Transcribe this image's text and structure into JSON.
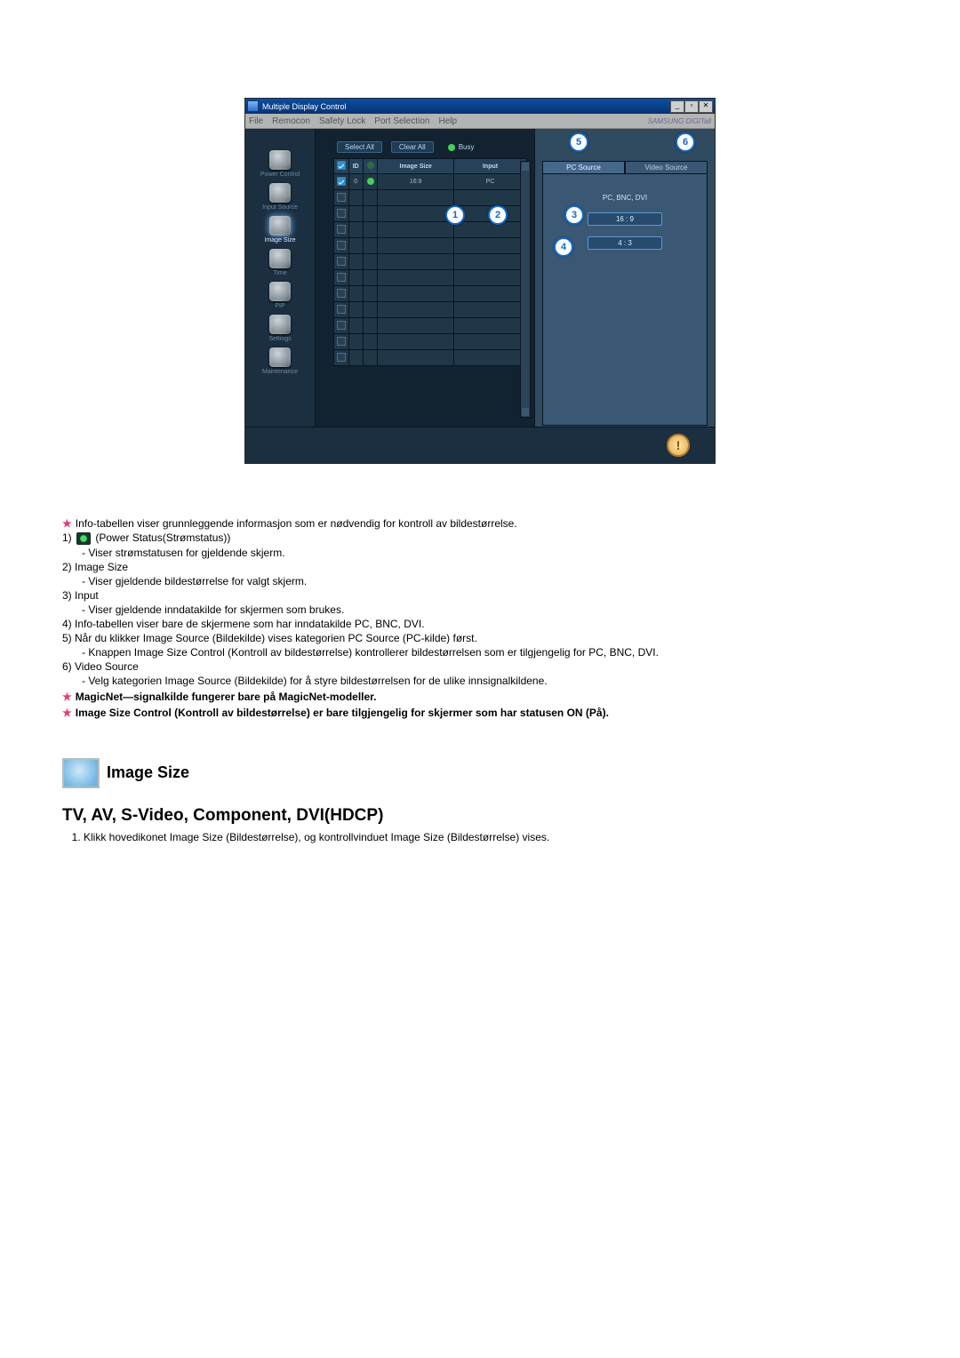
{
  "window": {
    "title": "Multiple Display Control",
    "win_buttons": [
      "_",
      "▫",
      "✕"
    ],
    "menus": [
      "File",
      "Remocon",
      "Safety Lock",
      "Port Selection",
      "Help"
    ],
    "brand": "SAMSUNG DIGITall"
  },
  "sidebar": {
    "items": [
      {
        "label": "Power Control"
      },
      {
        "label": "Input Source"
      },
      {
        "label": "Image Size"
      },
      {
        "label": "Time"
      },
      {
        "label": "PIP"
      },
      {
        "label": "Settings"
      },
      {
        "label": "Maintenance"
      }
    ]
  },
  "toolbar": {
    "select_all": "Select All",
    "clear_all": "Clear All",
    "busy": "Busy"
  },
  "grid": {
    "headers": {
      "chk": "",
      "id": "ID",
      "status": "",
      "size": "Image Size",
      "input": "Input"
    },
    "rows": [
      {
        "checked": true,
        "id": "0",
        "status": "on",
        "size": "16:9",
        "input": "PC"
      },
      {
        "checked": false,
        "id": "",
        "status": "",
        "size": "",
        "input": ""
      },
      {
        "checked": false,
        "id": "",
        "status": "",
        "size": "",
        "input": ""
      },
      {
        "checked": false,
        "id": "",
        "status": "",
        "size": "",
        "input": ""
      },
      {
        "checked": false,
        "id": "",
        "status": "",
        "size": "",
        "input": ""
      },
      {
        "checked": false,
        "id": "",
        "status": "",
        "size": "",
        "input": ""
      },
      {
        "checked": false,
        "id": "",
        "status": "",
        "size": "",
        "input": ""
      },
      {
        "checked": false,
        "id": "",
        "status": "",
        "size": "",
        "input": ""
      },
      {
        "checked": false,
        "id": "",
        "status": "",
        "size": "",
        "input": ""
      },
      {
        "checked": false,
        "id": "",
        "status": "",
        "size": "",
        "input": ""
      },
      {
        "checked": false,
        "id": "",
        "status": "",
        "size": "",
        "input": ""
      },
      {
        "checked": false,
        "id": "",
        "status": "",
        "size": "",
        "input": ""
      }
    ]
  },
  "right_panel": {
    "tabs": {
      "pc": "PC Source",
      "video": "Video Source"
    },
    "label": "PC, BNC, DVI",
    "btn1": "16 : 9",
    "btn2": "4 : 3"
  },
  "callouts": {
    "c1": "1",
    "c2": "2",
    "c3": "3",
    "c4": "4",
    "c5": "5",
    "c6": "6"
  },
  "doc": {
    "intro": "Info-tabellen viser grunnleggende informasjon som er nødvendig for kontroll av bildestørrelse.",
    "items": [
      {
        "num": "1)",
        "badge": true,
        "head": " (Power Status(Strømstatus))",
        "sub": "Viser strømstatusen for gjeldende skjerm."
      },
      {
        "num": "2)",
        "head": "Image Size",
        "sub": "Viser gjeldende bildestørrelse for valgt skjerm."
      },
      {
        "num": "3)",
        "head": "Input",
        "sub": "Viser gjeldende inndatakilde for skjermen som brukes."
      },
      {
        "num": "4)",
        "head": "Info-tabellen viser bare de skjermene som har inndatakilde PC, BNC, DVI."
      },
      {
        "num": "5)",
        "head": "Når du klikker Image Source (Bildekilde) vises kategorien PC Source (PC-kilde) først.",
        "sub": "Knappen Image Size Control (Kontroll av bildestørrelse) kontrollerer bildestørrelsen som er tilgjengelig for PC, BNC, DVI."
      },
      {
        "num": "6)",
        "head": "Video Source",
        "sub": "Velg kategorien Image Source (Bildekilde) for å styre bildestørrelsen for de ulike innsignalkildene."
      }
    ],
    "note1": "MagicNet—signalkilde fungerer bare på MagicNet-modeller.",
    "note2": "Image Size Control (Kontroll av bildestørrelse) er bare tilgjengelig for skjermer som har statusen ON (På).",
    "section_title": "Image Size",
    "subheading": "TV, AV, S-Video, Component, DVI(HDCP)",
    "step1": "Klikk hovedikonet Image Size (Bildestørrelse), og kontrollvinduet Image Size (Bildestørrelse) vises."
  }
}
